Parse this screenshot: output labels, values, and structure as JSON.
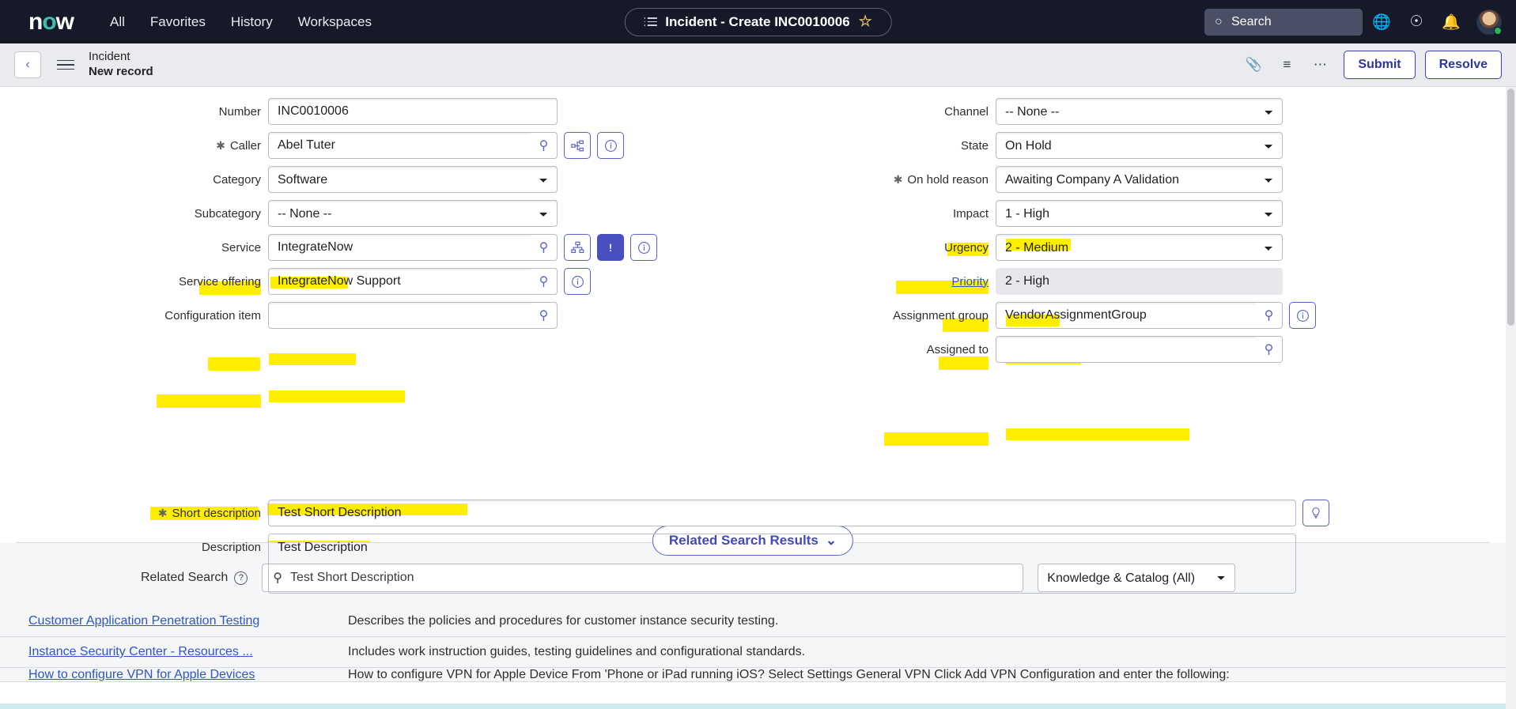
{
  "topnav": {
    "logo": {
      "part1": "n",
      "part2": "o",
      "part3": "w"
    },
    "links": [
      "All",
      "Favorites",
      "History",
      "Workspaces"
    ],
    "title_pill": {
      "label": "Incident - Create INC0010006",
      "list_icon": "list-icon",
      "star_icon": "star-icon"
    },
    "search_placeholder": "Search",
    "icons": {
      "globe": "globe-icon",
      "help": "help-icon",
      "bell": "bell-icon",
      "avatar": "avatar"
    }
  },
  "subbar": {
    "back_icon": "chevron-left-icon",
    "menu_icon": "hamburger-icon",
    "title_line1": "Incident",
    "title_line2": "New record",
    "attachment_icon": "paperclip-icon",
    "personalize_icon": "sliders-icon",
    "more_icon": "ellipsis-icon",
    "submit_label": "Submit",
    "resolve_label": "Resolve"
  },
  "form": {
    "left": {
      "number": {
        "label": "Number",
        "value": "INC0010006"
      },
      "caller": {
        "label": "Caller",
        "value": "Abel Tuter",
        "required": true
      },
      "category": {
        "label": "Category",
        "value": "Software",
        "highlighted": true
      },
      "subcategory": {
        "label": "Subcategory",
        "value": "-- None --"
      },
      "service": {
        "label": "Service",
        "value": "IntegrateNow",
        "highlighted": true
      },
      "service_offering": {
        "label": "Service offering",
        "value": "IntegrateNow Support",
        "highlighted": true
      },
      "configuration_item": {
        "label": "Configuration item",
        "value": ""
      },
      "short_description": {
        "label": "Short description",
        "value": "Test Short Description",
        "required": true,
        "highlighted": true
      },
      "description": {
        "label": "Description",
        "value": "Test Description",
        "highlighted": true
      }
    },
    "right": {
      "channel": {
        "label": "Channel",
        "value": "-- None --"
      },
      "state": {
        "label": "State",
        "value": "On Hold",
        "highlighted": true
      },
      "on_hold_reason": {
        "label": "On hold reason",
        "value": "Awaiting Company A Validation",
        "required": true,
        "highlighted": true
      },
      "impact": {
        "label": "Impact",
        "value": "1 - High",
        "highlighted": true
      },
      "urgency": {
        "label": "Urgency",
        "value": "2 - Medium",
        "highlighted": true
      },
      "priority": {
        "label": "Priority",
        "value": "2 - High",
        "readonly": true
      },
      "assignment_group": {
        "label": "Assignment group",
        "value": "VendorAssignmentGroup",
        "highlighted": true
      },
      "assigned_to": {
        "label": "Assigned to",
        "value": ""
      }
    },
    "icons": {
      "lookup": "magnifier-icon",
      "org_chart": "org-chart-icon",
      "info": "info-icon",
      "sitemap": "sitemap-icon",
      "alert": "alert-icon",
      "suggestion": "lightbulb-icon"
    }
  },
  "related": {
    "toggle_label": "Related Search Results",
    "toggle_icon": "chevron-down-icon",
    "search_label": "Related Search",
    "help_icon": "question-icon",
    "search_icon": "search-icon",
    "search_value": "Test Short Description",
    "filter_value": "Knowledge & Catalog (All)",
    "results": [
      {
        "title": "Customer Application Penetration Testing",
        "description": "Describes the policies and procedures for customer instance security testing."
      },
      {
        "title": "Instance Security Center - Resources ...",
        "description": "Includes work instruction guides, testing guidelines and configurational standards."
      },
      {
        "title": "How to configure VPN for Apple Devices",
        "description": "How to configure VPN for Apple Device From 'Phone or iPad running iOS? Select Settings General VPN Click Add VPN Configuration and enter the following:"
      }
    ]
  },
  "colors": {
    "nav_bg": "#161a28",
    "accent_teal": "#3bbfb0",
    "purple": "#5b62c4",
    "highlight": "#ffee00",
    "link": "#2f55c4"
  }
}
